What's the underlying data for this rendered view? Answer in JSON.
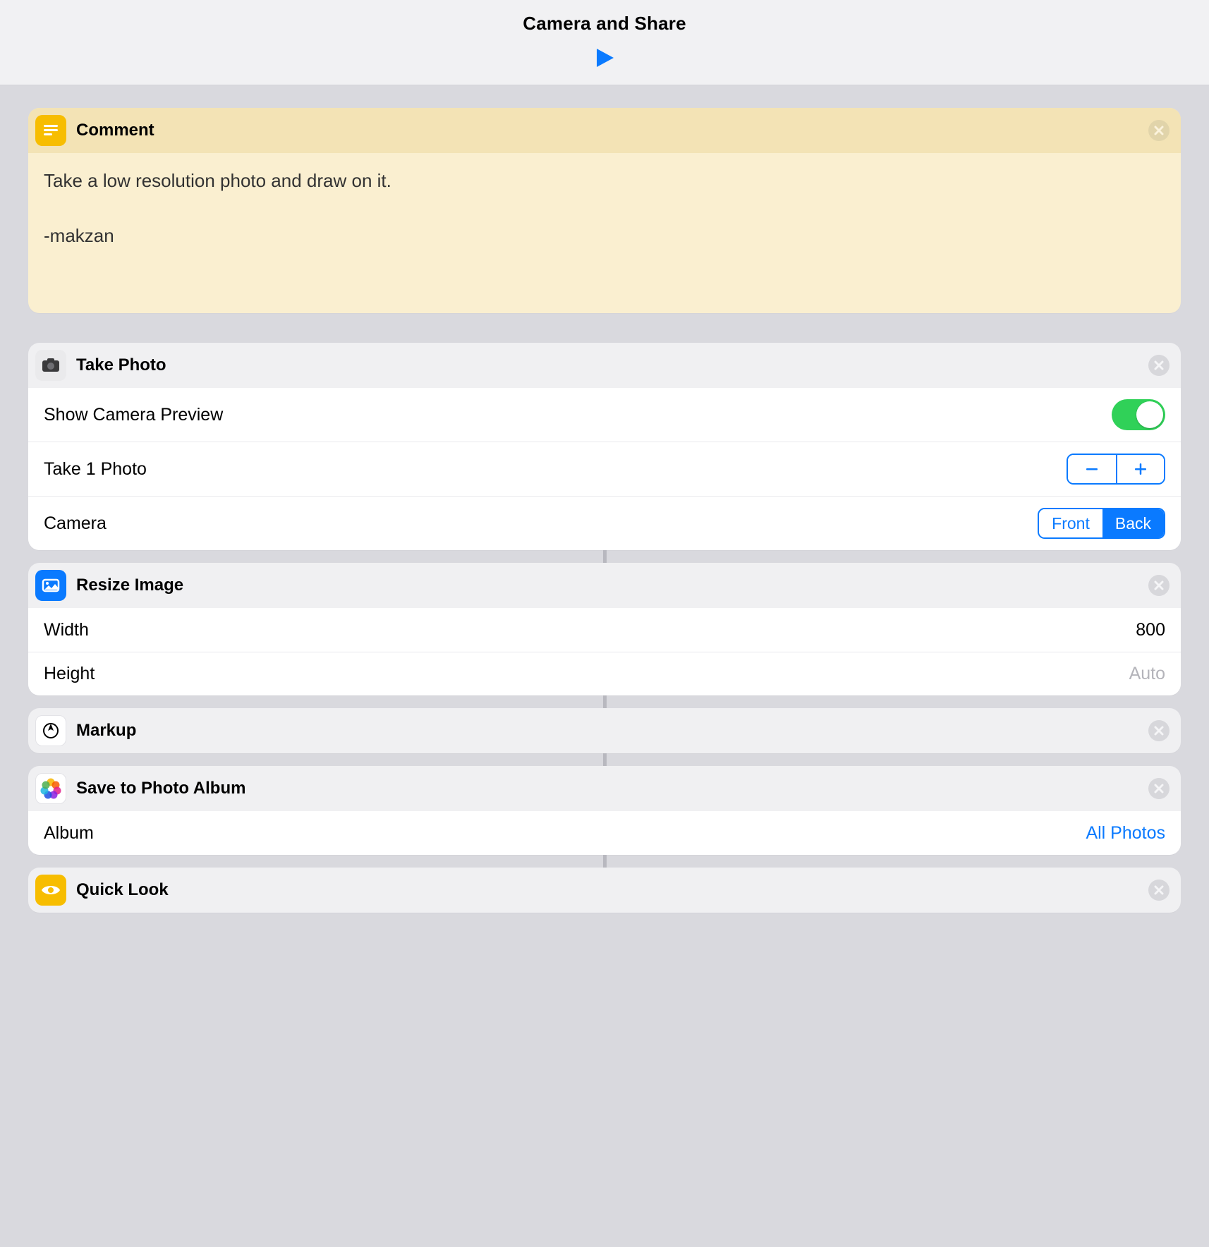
{
  "header": {
    "title": "Camera and Share"
  },
  "comment": {
    "title": "Comment",
    "body": "Take a low resolution photo and draw on it.\n\n-makzan"
  },
  "takePhoto": {
    "title": "Take Photo",
    "preview_label": "Show Camera Preview",
    "preview_on": true,
    "count_label": "Take 1 Photo",
    "camera_label": "Camera",
    "camera_options": {
      "front": "Front",
      "back": "Back"
    },
    "camera_selected": "back"
  },
  "resize": {
    "title": "Resize Image",
    "width_label": "Width",
    "width_value": "800",
    "height_label": "Height",
    "height_value": "Auto"
  },
  "markup": {
    "title": "Markup"
  },
  "saveAlbum": {
    "title": "Save to Photo Album",
    "album_label": "Album",
    "album_value": "All Photos"
  },
  "quickLook": {
    "title": "Quick Look"
  }
}
